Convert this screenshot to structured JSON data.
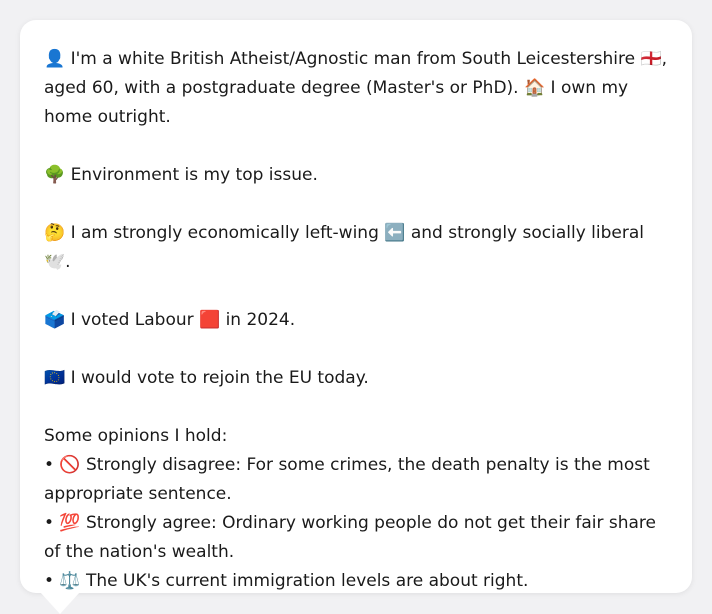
{
  "profile": {
    "intro": "👤 I'm a white British Atheist/Agnostic man from South Leicestershire 🏴󠁧󠁢󠁥󠁮󠁧󠁿, aged 60, with a postgraduate degree (Master's or PhD). 🏠 I own my home outright.",
    "top_issue": "🌳 Environment is my top issue.",
    "politics": "🤔 I am strongly economically left-wing ⬅️ and strongly socially liberal 🕊️.",
    "vote": "🗳️ I voted Labour 🟥 in 2024.",
    "eu": "🇪🇺 I would vote to rejoin the EU today.",
    "opinions_heading": "Some opinions I hold:",
    "opinions": [
      "• 🚫 Strongly disagree: For some crimes, the death penalty is the most appropriate sentence.",
      "• 💯 Strongly agree: Ordinary working people do not get their fair share of the nation's wealth.",
      "• ⚖️ The UK's current immigration levels are about right."
    ]
  }
}
